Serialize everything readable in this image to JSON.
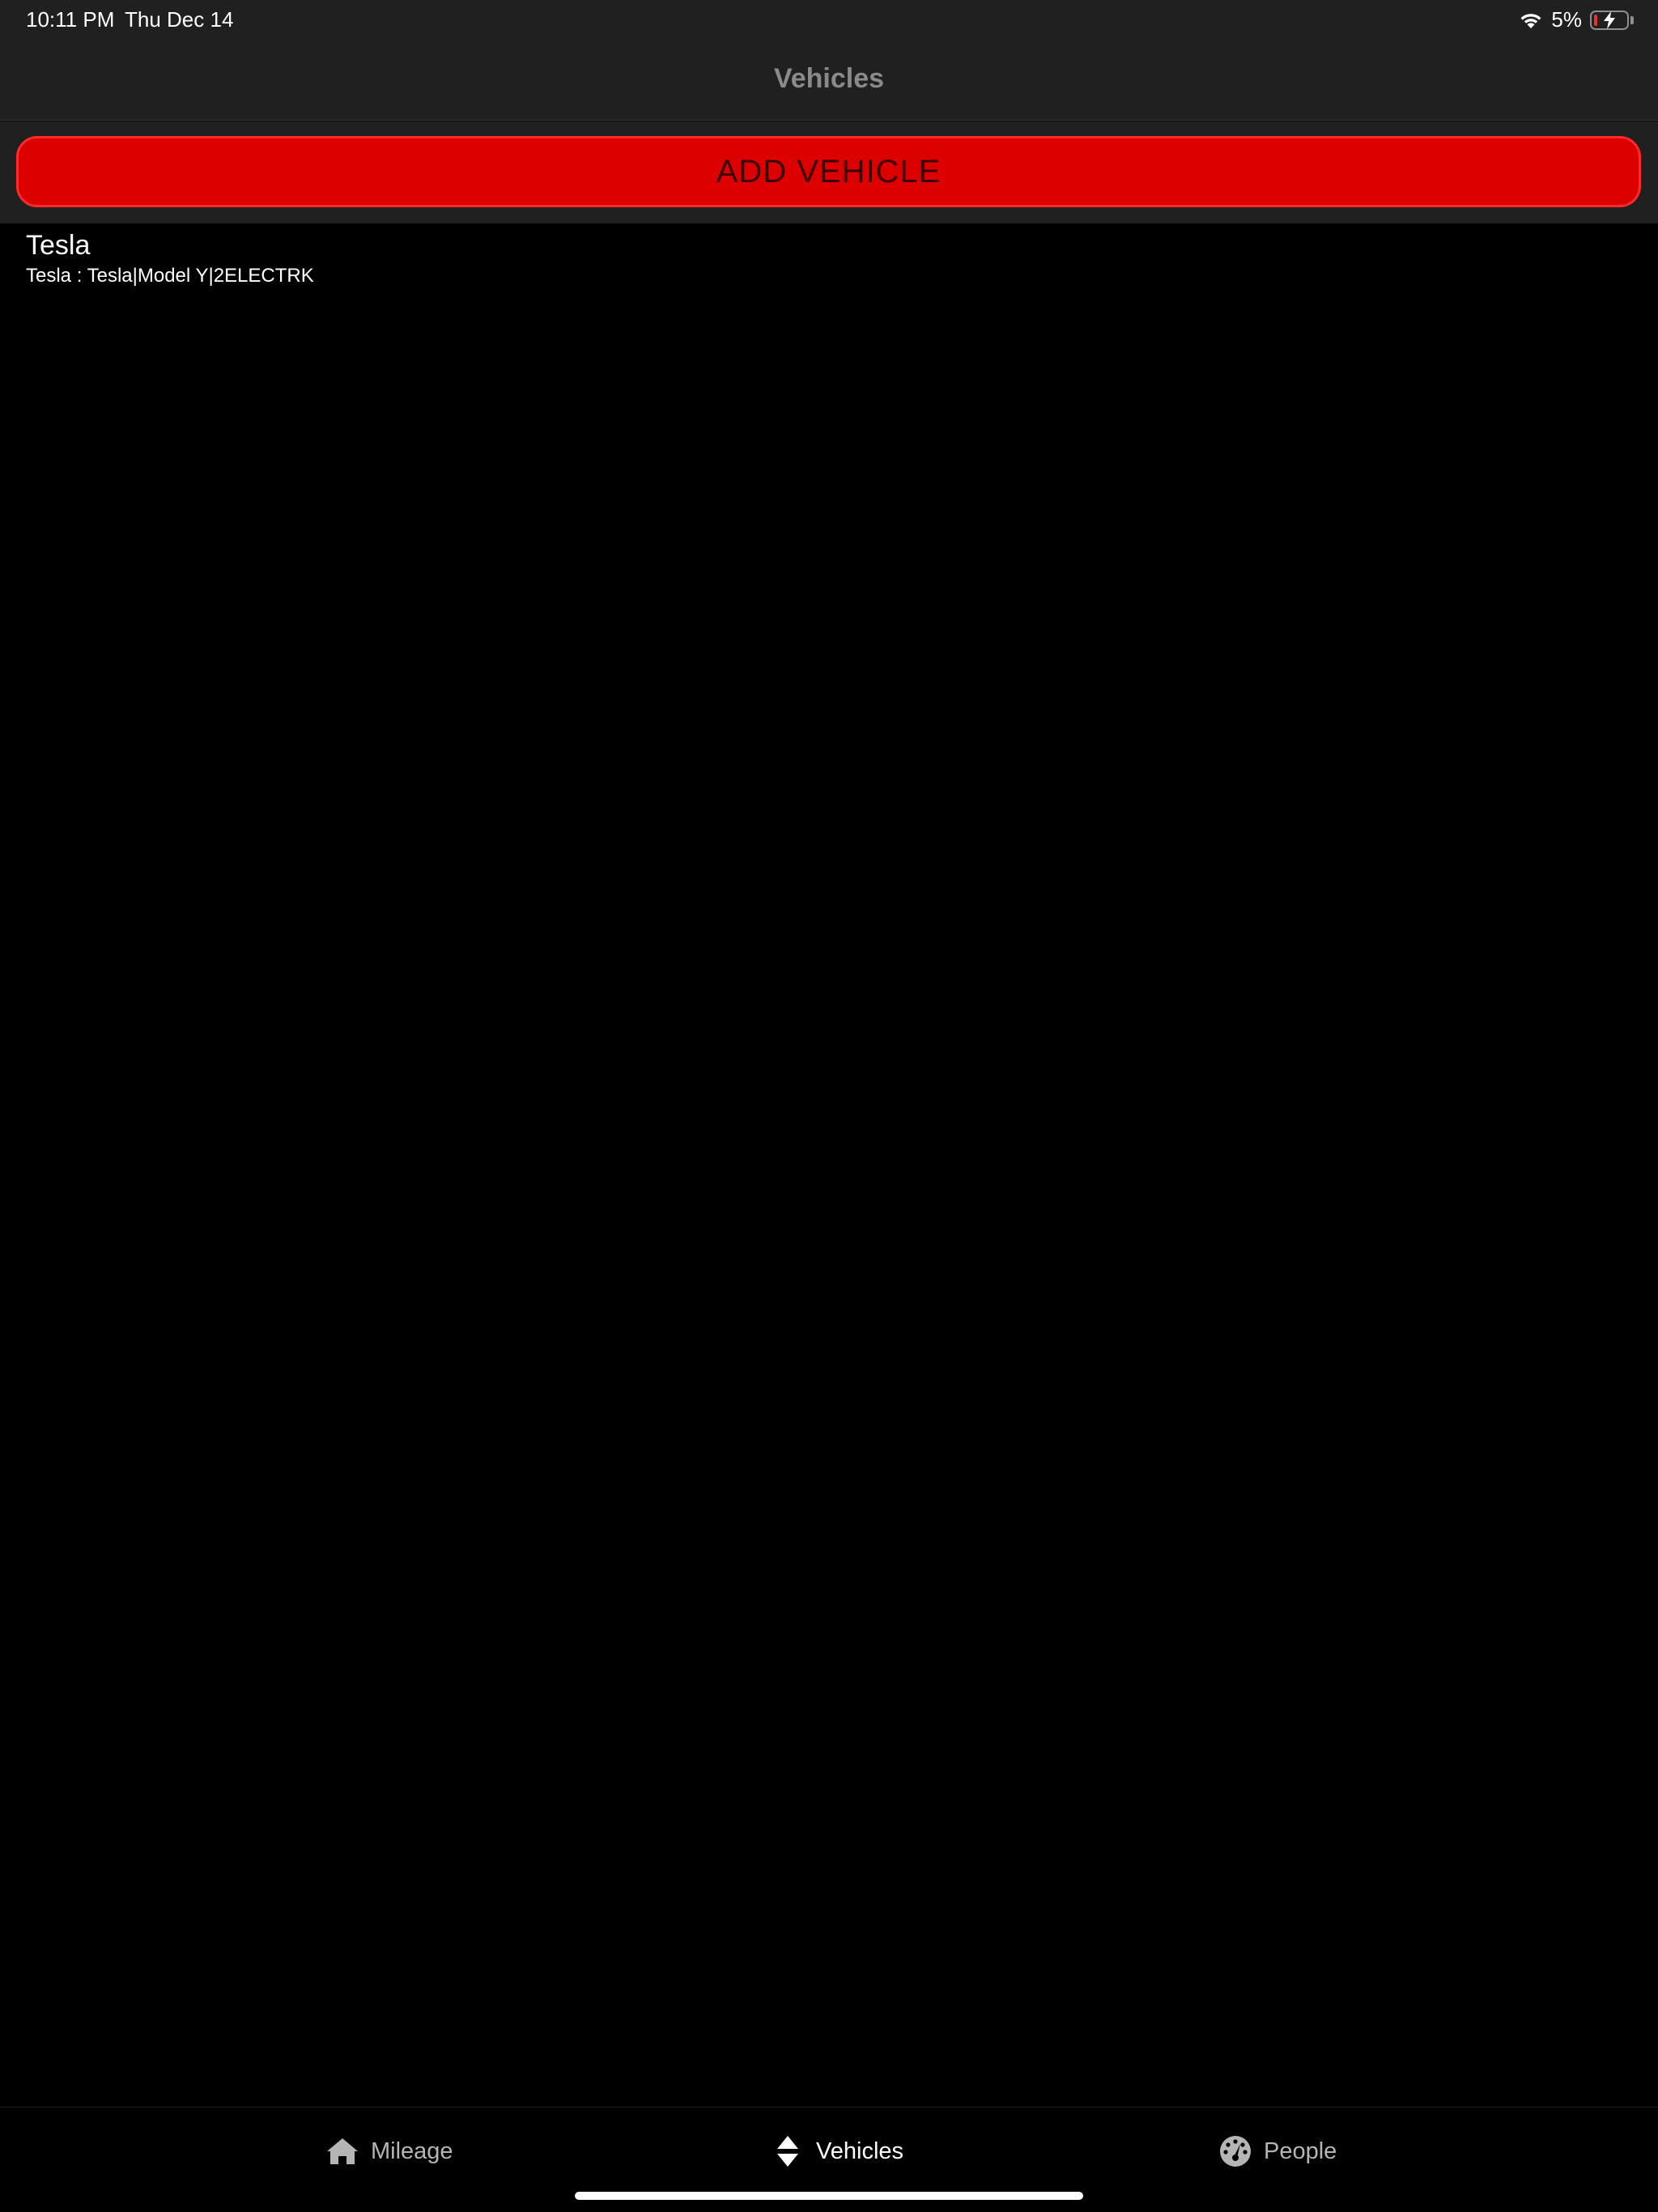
{
  "status_bar": {
    "time": "10:11 PM",
    "date": "Thu Dec 14",
    "battery_percent": "5%",
    "battery_level": 0.05,
    "battery_charging": true,
    "icons": [
      "wifi-icon",
      "battery-icon",
      "charging-bolt-icon"
    ]
  },
  "header": {
    "title": "Vehicles"
  },
  "actions": {
    "add_vehicle_label": "ADD VEHICLE",
    "add_vehicle_color": "#dd0000"
  },
  "vehicles": [
    {
      "name": "Tesla",
      "detail": "Tesla : Tesla|Model Y|2ELECTRK"
    }
  ],
  "tab_bar": {
    "tabs": [
      {
        "label": "Mileage",
        "icon": "home-icon",
        "active": false
      },
      {
        "label": "Vehicles",
        "icon": "sort-icon",
        "active": true
      },
      {
        "label": "People",
        "icon": "dashboard-icon",
        "active": false
      }
    ]
  },
  "colors": {
    "background": "#000000",
    "bar_background": "#202020",
    "accent_red": "#dd0000",
    "active_tab": "#ffffff",
    "inactive_tab": "#b5b5b5"
  }
}
